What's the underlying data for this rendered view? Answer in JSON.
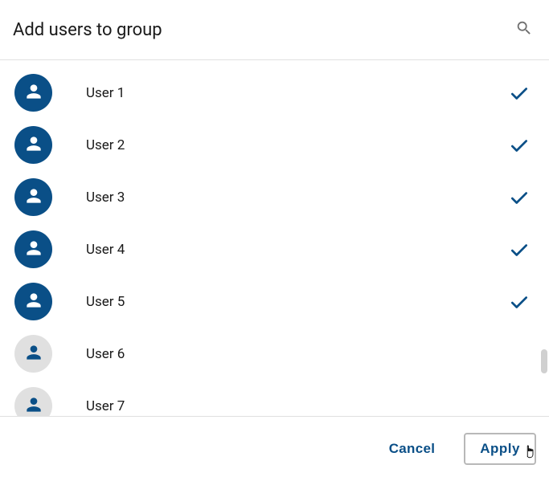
{
  "dialog": {
    "title": "Add users to group"
  },
  "users": [
    {
      "name": "User 1",
      "selected": true
    },
    {
      "name": "User 2",
      "selected": true
    },
    {
      "name": "User 3",
      "selected": true
    },
    {
      "name": "User 4",
      "selected": true
    },
    {
      "name": "User 5",
      "selected": true
    },
    {
      "name": "User 6",
      "selected": false
    },
    {
      "name": "User 7",
      "selected": false
    }
  ],
  "footer": {
    "cancel_label": "Cancel",
    "apply_label": "Apply"
  },
  "colors": {
    "accent": "#0a4f87",
    "avatar_unselected_bg": "#e0e0e0"
  }
}
